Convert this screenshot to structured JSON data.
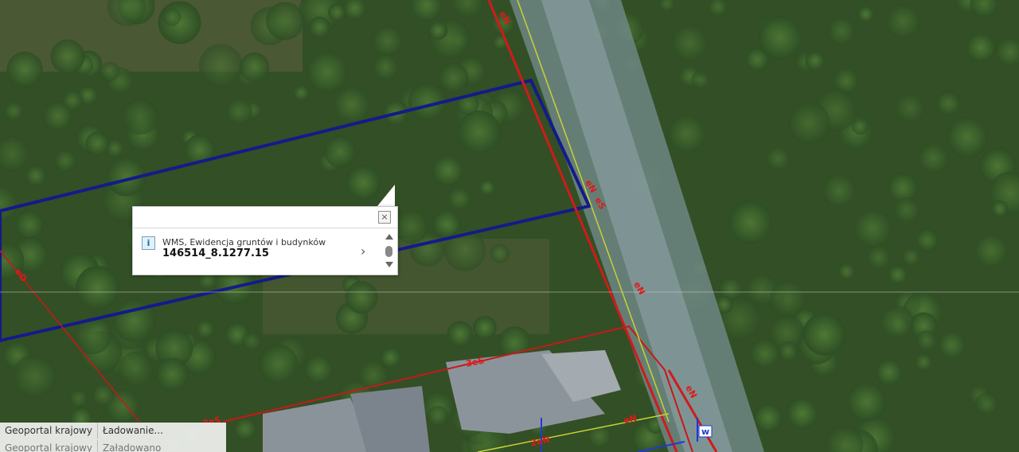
{
  "map": {
    "labels": [
      {
        "text": "eN",
        "rot": 60
      },
      {
        "text": "eN",
        "rot": 60
      },
      {
        "text": "eS",
        "rot": 60
      },
      {
        "text": "eN",
        "rot": 60
      },
      {
        "text": "eN",
        "rot": 60
      },
      {
        "text": "eO",
        "rot": 55
      },
      {
        "text": "3eS",
        "rot": -12
      },
      {
        "text": "3eS",
        "rot": -12
      },
      {
        "text": "2eN",
        "rot": -12
      },
      {
        "text": "eN",
        "rot": -12
      },
      {
        "text": "w",
        "rot": 0
      }
    ]
  },
  "popup": {
    "close_label": "×",
    "info_icon": "i",
    "source": "WMS, Ewidencja gruntów i budynków",
    "parcel_id": "146514_8.1277.15",
    "next_icon": "›"
  },
  "status": {
    "line1_left": "Geoportal krajowy",
    "line1_right": "Ładowanie...",
    "line2_left": "Geoportal krajowy",
    "line2_right": "Załadowano"
  }
}
